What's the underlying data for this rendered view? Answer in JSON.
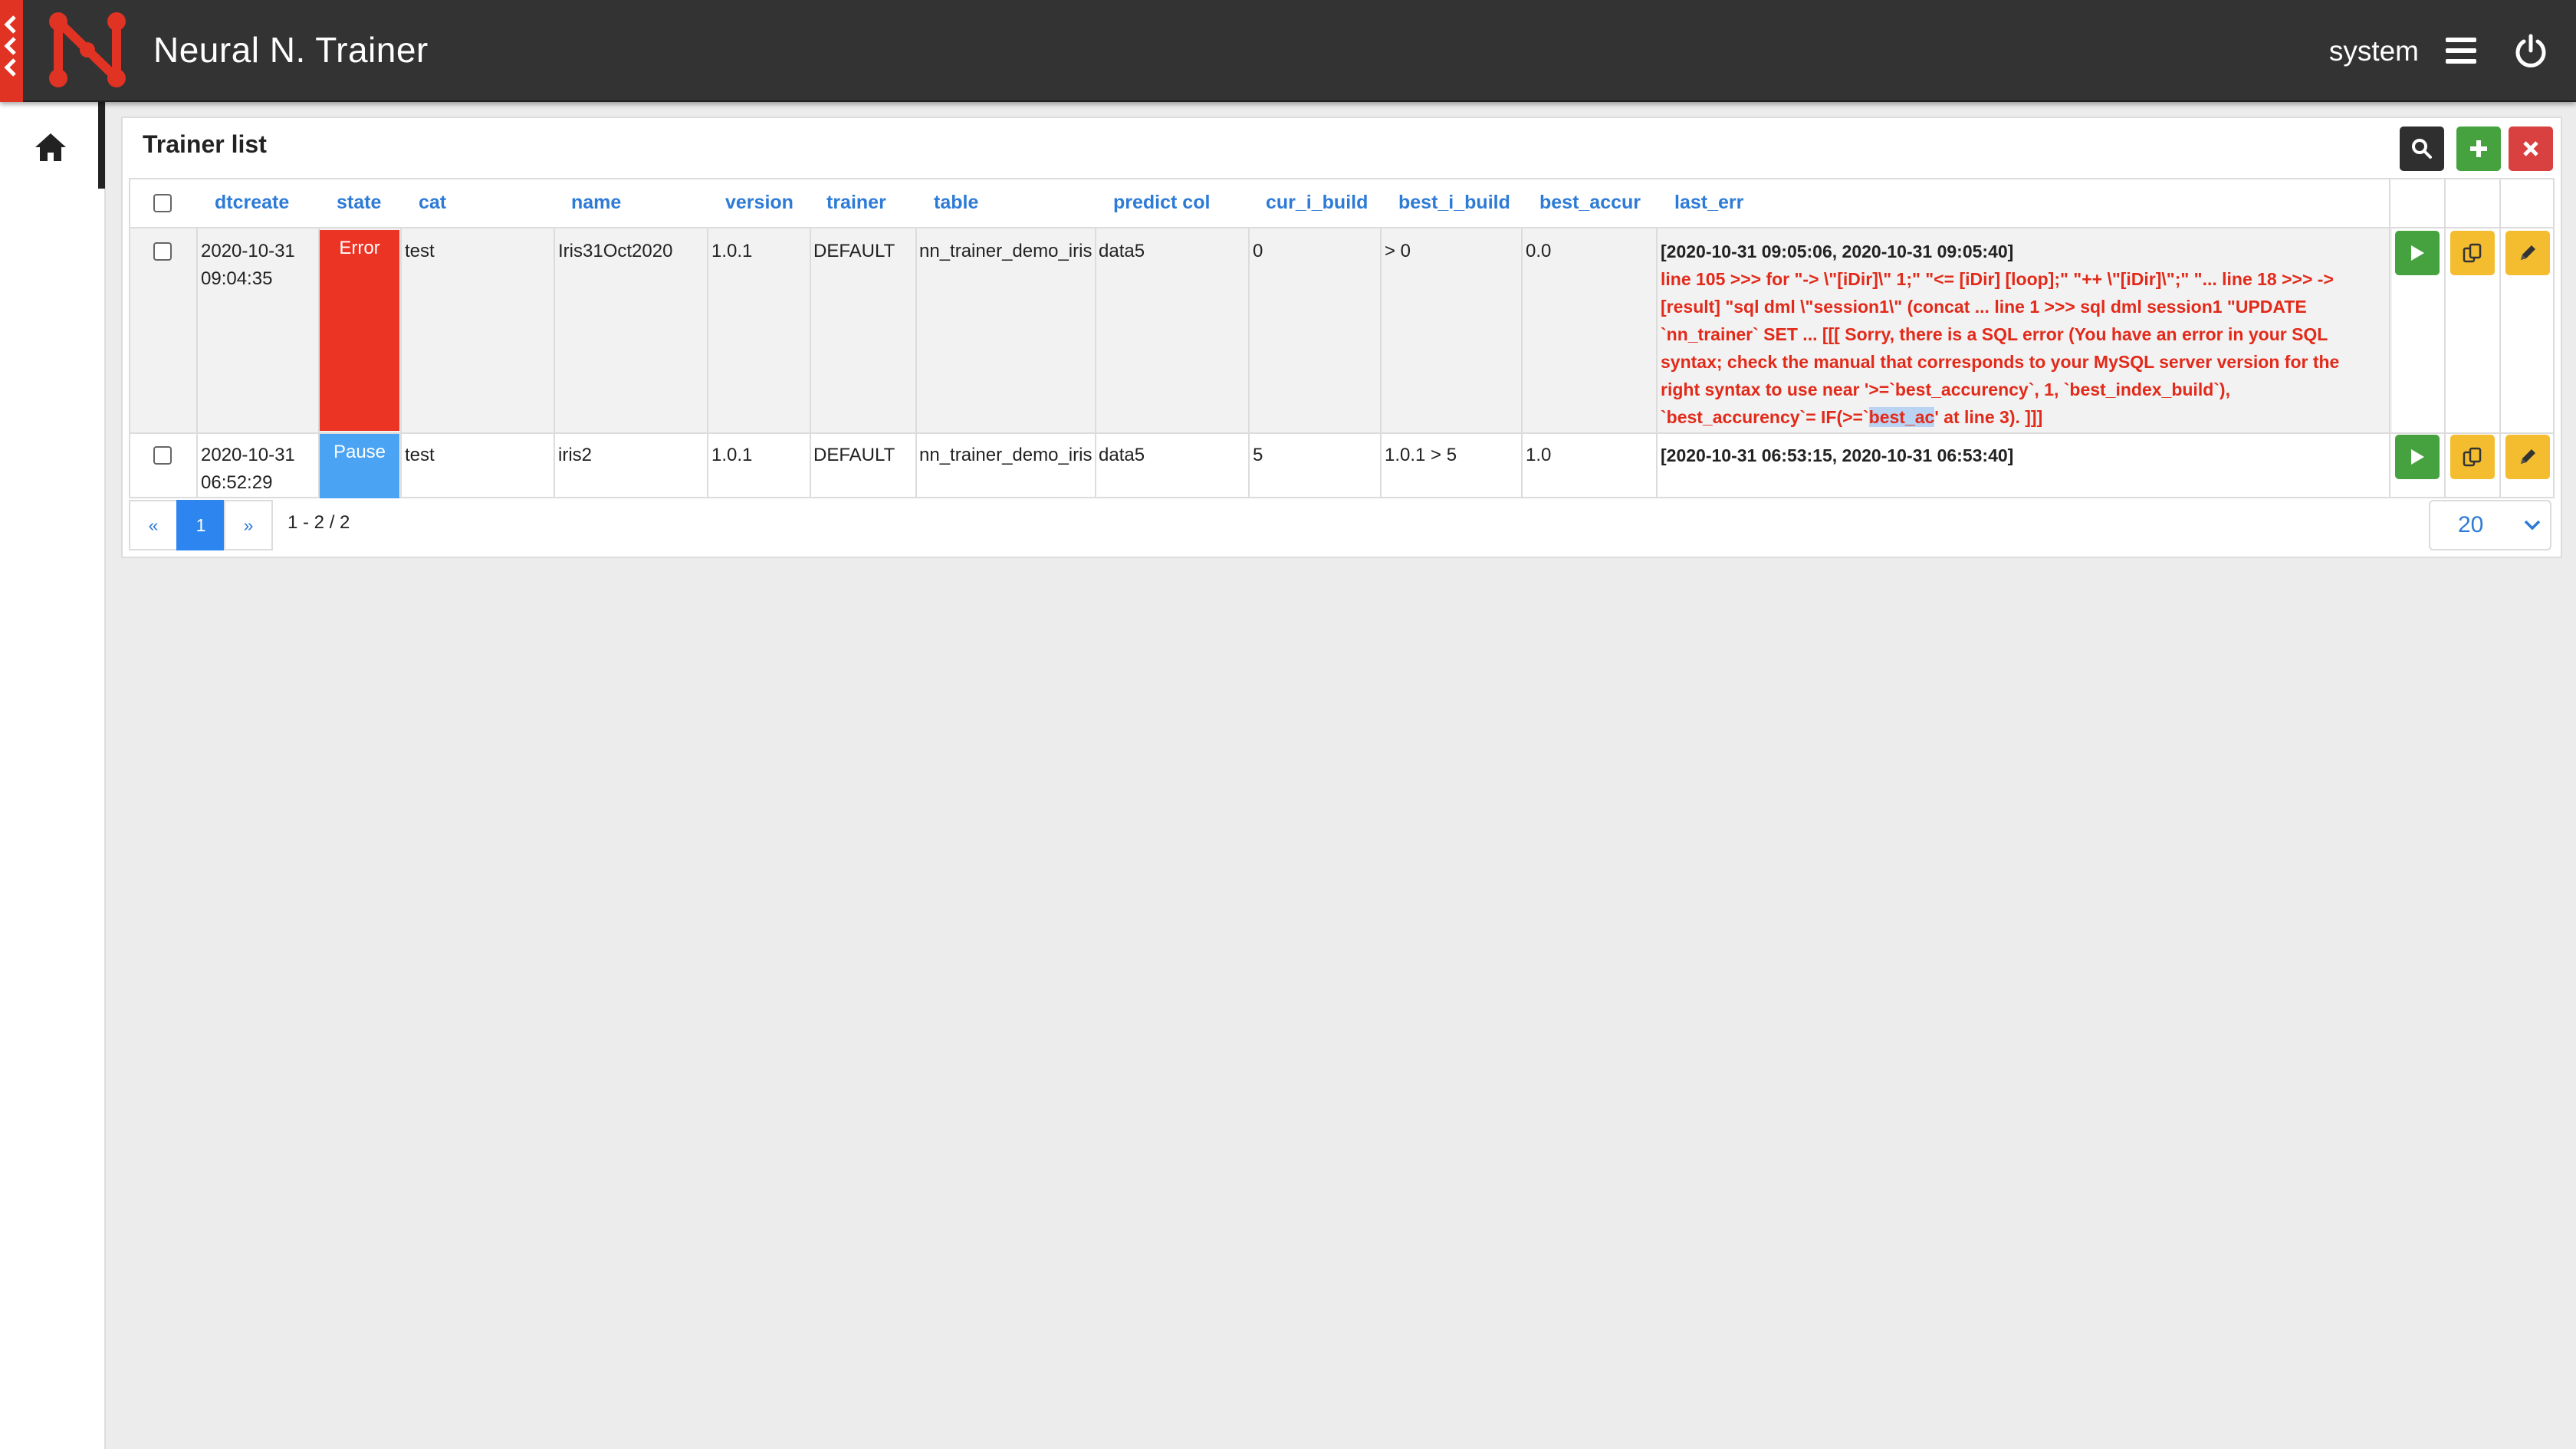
{
  "app": {
    "title": "Neural N. Trainer",
    "user": "system"
  },
  "panel": {
    "title": "Trainer list"
  },
  "table": {
    "headers": {
      "dtcreate": "dtcreate",
      "state": "state",
      "cat": "cat",
      "name": "name",
      "version": "version",
      "trainer": "trainer",
      "table": "table",
      "predict_col": "predict col",
      "cur_i_build": "cur_i_build",
      "best_i_build": "best_i_build",
      "best_accur": "best_accur",
      "last_err": "last_err"
    },
    "rows": [
      {
        "date": "2020-10-31",
        "time": "09:04:35",
        "state": "Error",
        "cat": "test",
        "name": "Iris31Oct2020",
        "version": "1.0.1",
        "trainer": "DEFAULT",
        "table": "nn_trainer_demo_iris",
        "predict_col": "data5",
        "cur_i_build": "0",
        "best_i_build": "> 0",
        "best_accur": "0.0",
        "err_header": "[2020-10-31 09:05:06, 2020-10-31 09:05:40]",
        "err_lines": [
          "line 105 >>> for \"-> \\\"[iDir]\\\" 1;\" \"<= [iDir] [loop];\" \"++ \\\"[iDir]\\\";\" \"... line 18 >>> ->",
          "[result] \"sql dml \\\"session1\\\" (concat ... line 1 >>> sql dml session1 \"UPDATE",
          "`nn_trainer` SET ... [[[ Sorry, there is a SQL error (You have an error in your SQL",
          "syntax; check the manual that corresponds to your MySQL server version for the",
          "right syntax to use near '>=`best_accurency`, 1, `best_index_build`),"
        ],
        "err_last_pre": "`best_accurency`= IF(>=`",
        "err_last_hl": "best_ac",
        "err_last_post": "' at line 3). ]]]"
      },
      {
        "date": "2020-10-31",
        "time": "06:52:29",
        "state": "Pause",
        "cat": "test",
        "name": "iris2",
        "version": "1.0.1",
        "trainer": "DEFAULT",
        "table": "nn_trainer_demo_iris",
        "predict_col": "data5",
        "cur_i_build": "5",
        "best_i_build": "1.0.1 > 5",
        "best_accur": "1.0",
        "err_header": "[2020-10-31 06:53:15, 2020-10-31 06:53:40]"
      }
    ]
  },
  "pagination": {
    "prev": "«",
    "current": "1",
    "next": "»",
    "info": "1 - 2 / 2",
    "page_size": "20"
  },
  "colors": {
    "topbar": "#333333",
    "brand_red": "#e03323",
    "error": "#ec3425",
    "pause": "#4aa3f3",
    "link": "#2d7bd6",
    "run": "#46a23f",
    "edit": "#f3bd2f"
  }
}
